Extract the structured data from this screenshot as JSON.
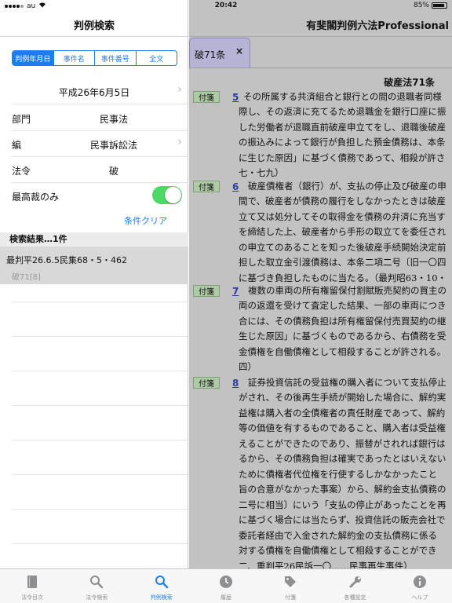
{
  "status": {
    "carrier": "au",
    "time": "20:42",
    "battery": "85%",
    "battery_level": 0.85
  },
  "left": {
    "title": "判例検索",
    "segments": [
      "判例年月日",
      "事件名",
      "事件番号",
      "全文"
    ],
    "active_segment": 0,
    "date": "平成26年6月5日",
    "rows": [
      {
        "label": "部門",
        "value": "民事法"
      },
      {
        "label": "編",
        "value": "民事訴訟法"
      },
      {
        "label": "法令",
        "value": "破"
      }
    ],
    "toggle_label": "最高裁のみ",
    "toggle_on": true,
    "clear_label": "条件クリア",
    "results_header": "検索結果…1件",
    "result": {
      "line1": "最判平26.6.5民集68・5・462",
      "line2": "破71[8]"
    }
  },
  "right": {
    "app_title": "有斐閣判例六法Professional",
    "tab_label": "破71条",
    "close_label": "×",
    "doc_title": "破産法71条",
    "fusen_label": "付箋",
    "entries": [
      {
        "num": "5",
        "lines": [
          "その所属する共済組合と銀行との間の退職者同様",
          "際し、その返済に充てるため退職金を銀行口座に振",
          "した労働者が退職直前破産申立てをし、退職後破産",
          "の振込みによって銀行が負担した預金債務は、本条",
          "に生じた原因」に基づく債務であって、相殺が許さ",
          "七・七九）"
        ]
      },
      {
        "num": "6",
        "lines": [
          "破産債権者（銀行）が、支払の停止及び破産の申",
          "間で、破産者が債務の履行をしなかったときは破産",
          "立て又は処分してその取得金を債務の弁済に充当す",
          "を締結した上、破産者から手形の取立てを委任され",
          "の申立てのあることを知った後破産手続開始決定前",
          "担した取立金引渡債務は、本条二項二号〔旧一〇四",
          "に基づき負担したものに当たる。（最判昭63・10・"
        ]
      },
      {
        "num": "7",
        "lines": [
          "複数の車両の所有権留保付割賦販売契約の買主の",
          "両の返還を受けて査定した結果、一部の車両につき",
          "合には、その債務負担は所有権留保付売買契約の継",
          "生じた原因」に基づくものであるから、右債務を受",
          "金債権を自働債権として相殺することが許される。",
          "四）"
        ]
      },
      {
        "num": "8",
        "lines": [
          "証券投資信託の受益権の購入者について支払停止",
          "がされ、その後再生手続が開始した場合に、解約実",
          "益権は購入者の全債権者の責任財産であって、解約",
          "等の価値を有するものであること、購入者は受益権",
          "えることができたのであり、振替がされれば銀行は",
          "るから、その債務負担は確実であったとはいえない",
          "ために債権者代位権を行使するしかなかったこと",
          "旨の合意がなかった事案）から、解約金支払債務の",
          "二号に相当〕にいう「支払の停止があったことを再",
          "に基づく場合には当たらず、投資信託の販売会社で",
          "委託者経由で入金された解約金の支払債務に係る",
          "対する債権を自働債権として相殺することができ",
          "二、重判平26民訴一〇……民事再生事件）"
        ]
      }
    ]
  },
  "tabbar": {
    "items": [
      {
        "label": "法令目次",
        "icon": "book-icon"
      },
      {
        "label": "法令検索",
        "icon": "search-icon"
      },
      {
        "label": "判例検索",
        "icon": "search-icon"
      },
      {
        "label": "履歴",
        "icon": "clock-icon"
      },
      {
        "label": "付箋",
        "icon": "tag-icon"
      },
      {
        "label": "各種設定",
        "icon": "wrench-icon"
      },
      {
        "label": "ヘルプ",
        "icon": "info-icon"
      }
    ],
    "active": 2,
    "active_color": "#1e7cf2",
    "inactive_color": "#8e8e93"
  }
}
